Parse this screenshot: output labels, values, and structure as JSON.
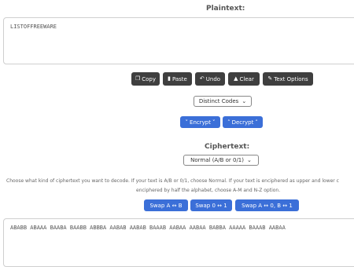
{
  "plaintext": {
    "heading": "Plaintext:",
    "value": "LISTOFFREEWARE"
  },
  "toolbar": {
    "copy": "Copy",
    "paste": "Paste",
    "undo": "Undo",
    "clear": "Clear",
    "text_options": "Text Options"
  },
  "mode_select": {
    "selected": "Distinct Codes"
  },
  "actions": {
    "encrypt": "Encrypt",
    "decrypt": "Decrypt"
  },
  "ciphertext": {
    "heading": "Ciphertext:",
    "format_selected": "Normal (A/B or 0/1)",
    "help_line1": "Choose what kind of ciphertext you want to decode. If your text is A/B or 0/1, choose Normal. If your text is enciphered as upper and lower c",
    "help_line2": "enciphered by half the alphabet, choose A-M and N-Z option.",
    "value": "ABABB ABAAA BAABA BAABB ABBBA AABAB AABAB BAAAB AABAA AABAA BABBA AAAAA BAAAB AABAA"
  },
  "swap": {
    "ab": "Swap A ↔ B",
    "zero_one": "Swap 0 ↔ 1",
    "both": "Swap A ↔ 0, B ↔ 1"
  },
  "icons": [
    "copy-icon",
    "paste-icon",
    "undo-icon",
    "eraser-icon",
    "magic-wand-icon",
    "chevron-down-icon",
    "chevron-up-icon"
  ]
}
